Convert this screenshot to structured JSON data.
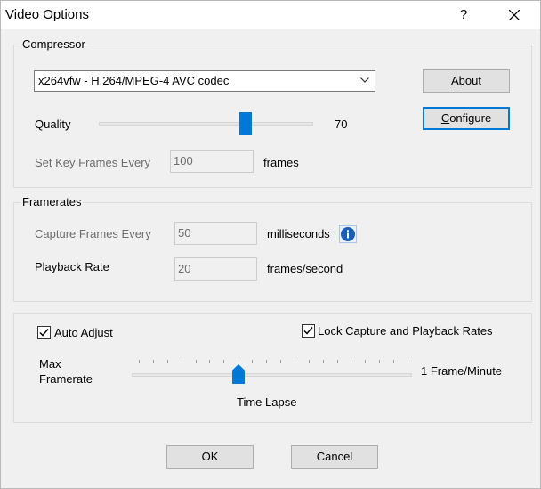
{
  "window": {
    "title": "Video Options",
    "help_label": "?"
  },
  "compressor": {
    "group_label": "Compressor",
    "codec_selected": "x264vfw - H.264/MPEG-4 AVC codec",
    "about_label": "About",
    "configure_label": "Configure",
    "quality_label": "Quality",
    "quality_value": "70",
    "keyframes_label": "Set Key Frames Every",
    "keyframes_value": "100",
    "keyframes_unit": "frames"
  },
  "framerates": {
    "group_label": "Framerates",
    "capture_label": "Capture Frames Every",
    "capture_value": "50",
    "capture_unit": "milliseconds",
    "playback_label": "Playback Rate",
    "playback_value": "20",
    "playback_unit": "frames/second"
  },
  "timelapse": {
    "auto_adjust_label": "Auto Adjust",
    "auto_adjust_checked": true,
    "lock_rates_label": "Lock Capture and Playback Rates",
    "lock_rates_checked": true,
    "max_label_line1": "Max",
    "max_label_line2": "Framerate",
    "min_label": "1 Frame/Minute",
    "slider_caption": "Time Lapse",
    "slider_level": 0.38
  },
  "footer": {
    "ok_label": "OK",
    "cancel_label": "Cancel"
  },
  "colors": {
    "accent": "#0078d7",
    "face": "#f0f0f0",
    "info": "#1a5fb4"
  }
}
